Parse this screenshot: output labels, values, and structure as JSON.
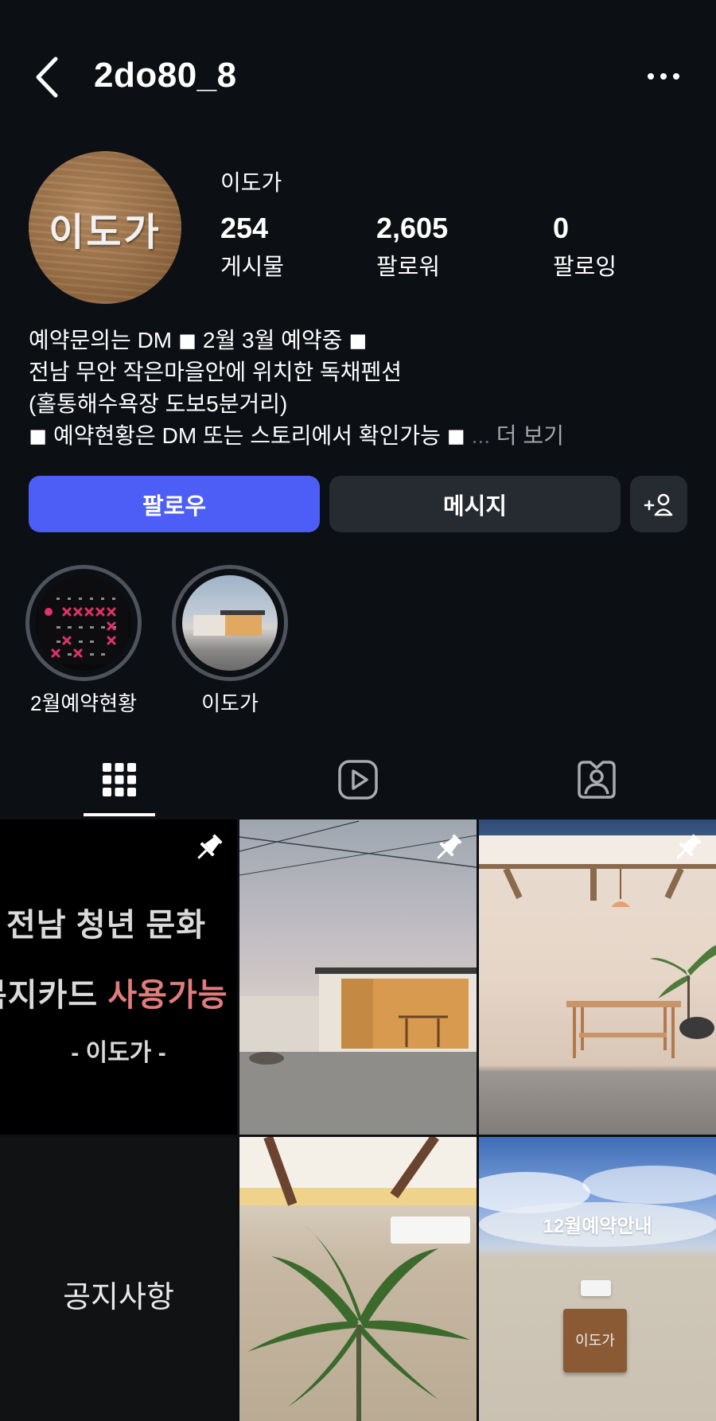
{
  "header": {
    "username": "2do80_8"
  },
  "profile": {
    "avatar_text": "이도가",
    "display_name": "이도가",
    "stats": [
      {
        "value": "254",
        "label": "게시물"
      },
      {
        "value": "2,605",
        "label": "팔로워"
      },
      {
        "value": "0",
        "label": "팔로잉"
      }
    ],
    "bio_lines": [
      "예약문의는 DM ◼︎ 2월 3월 예약중 ◼︎",
      "전남 무안 작은마을안에 위치한 독채펜션",
      "(홀통해수욕장 도보5분거리)",
      " ◼︎  예약현황은 DM 또는 스토리에서 확인가능 ◼︎"
    ],
    "bio_ellipsis": "...",
    "bio_more": "더 보기"
  },
  "actions": {
    "follow_label": "팔로우",
    "message_label": "메시지"
  },
  "highlights": [
    {
      "label": "2월예약현황"
    },
    {
      "label": "이도가"
    }
  ],
  "grid": {
    "post1": {
      "line1": "전남 청년 문화",
      "line2_white": "복지카드 ",
      "line2_red": "사용가능",
      "line3": "- 이도가 -"
    },
    "post4": {
      "text": "공지사항"
    },
    "post6": {
      "title": "12월예약안내",
      "plaque": "이도가"
    }
  },
  "colors": {
    "background": "#0c0f14",
    "follow_button": "#4d5ef6",
    "secondary_button": "#262a31",
    "highlight_ring": "#4f545c"
  }
}
